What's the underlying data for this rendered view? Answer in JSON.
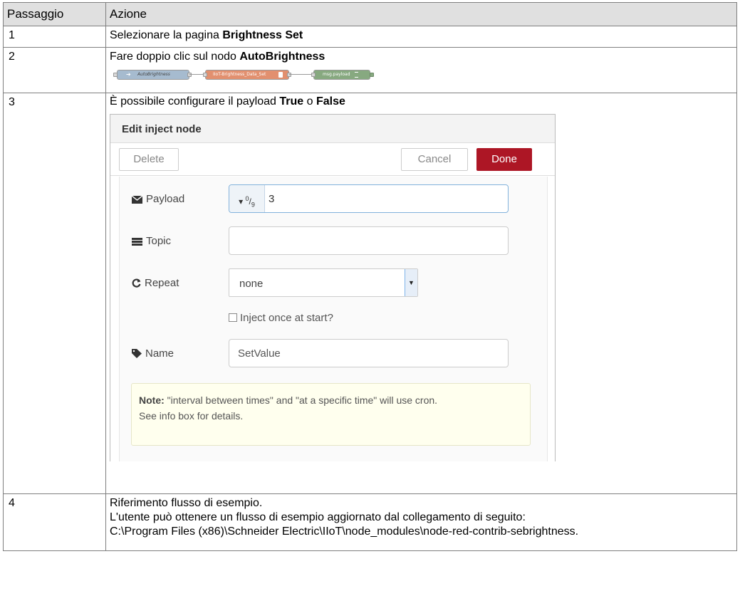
{
  "header": {
    "col1": "Passaggio",
    "col2": "Azione"
  },
  "steps": [
    {
      "num": "1",
      "text_before": "Selezionare la pagina ",
      "bold": "Brightness Set"
    },
    {
      "num": "2",
      "text_before": "Fare doppio clic sul nodo ",
      "bold": "AutoBrightness",
      "flow": {
        "inject_label": "AutoBrightness",
        "function_label": "IIoT-Brightness_Data_Set",
        "debug_label": "msg.payload",
        "colors": {
          "inject": "#a6bbcf",
          "function": "#e2906f",
          "debug": "#87a980"
        }
      }
    },
    {
      "num": "3",
      "text_before": "È possibile configurare il payload ",
      "bold1": "True",
      "mid": " o ",
      "bold2": "False"
    },
    {
      "num": "4",
      "line1": "Riferimento flusso di esempio.",
      "line2": "L'utente può ottenere un flusso di esempio aggiornato dal collegamento di seguito:",
      "line3": "C:\\Program Files (x86)\\Schneider Electric\\IIoT\\node_modules\\node-red-contrib-sebrightness."
    }
  ],
  "dialog": {
    "title": "Edit inject node",
    "delete_label": "Delete",
    "cancel_label": "Cancel",
    "done_label": "Done",
    "payload_label": "Payload",
    "payload_type": "0 9",
    "payload_value": "3",
    "topic_label": "Topic",
    "topic_value": "",
    "repeat_label": "Repeat",
    "repeat_value": "none",
    "inject_once_label": "Inject once at start?",
    "name_label": "Name",
    "name_value": "SetValue",
    "note_bold": "Note:",
    "note_text": " \"interval between times\" and \"at a specific time\" will use cron.",
    "note_line2": "See info box for details.",
    "accent": "#ad1625"
  }
}
